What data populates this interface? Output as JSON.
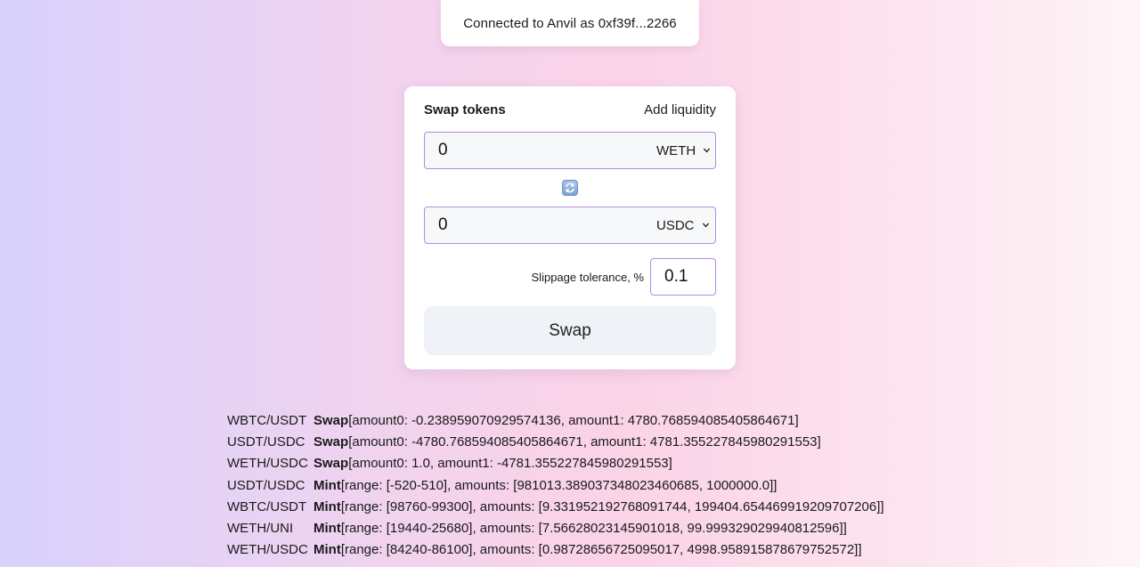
{
  "status": {
    "connected_text": "Connected to Anvil as 0xf39f...2266"
  },
  "tabs": {
    "swap_label": "Swap tokens",
    "liquidity_label": "Add liquidity"
  },
  "swap_form": {
    "from": {
      "amount": "0",
      "token": "WETH"
    },
    "to": {
      "amount": "0",
      "token": "USDC"
    },
    "switch_icon": "swap-arrows-icon",
    "slippage_label": "Slippage tolerance, %",
    "slippage_value": "0.1",
    "submit_label": "Swap"
  },
  "events": [
    {
      "pair": "WBTC/USDT",
      "type": "Swap",
      "details": "[amount0: -0.238959070929574136, amount1: 4780.768594085405864671]"
    },
    {
      "pair": "USDT/USDC",
      "type": "Swap",
      "details": "[amount0: -4780.768594085405864671, amount1: 4781.355227845980291553]"
    },
    {
      "pair": "WETH/USDC",
      "type": "Swap",
      "details": "[amount0: 1.0, amount1: -4781.355227845980291553]"
    },
    {
      "pair": "USDT/USDC",
      "type": "Mint",
      "details": "[range: [-520-510], amounts: [981013.389037348023460685, 1000000.0]]"
    },
    {
      "pair": "WBTC/USDT",
      "type": "Mint",
      "details": "[range: [98760-99300], amounts: [9.331952192768091744, 199404.654469919209707206]]"
    },
    {
      "pair": "WETH/UNI",
      "type": "Mint",
      "details": "[range: [19440-25680], amounts: [7.56628023145901018, 99.999329029940812596]]"
    },
    {
      "pair": "WETH/USDC",
      "type": "Mint",
      "details": "[range: [84240-86100], amounts: [0.98728656725095017, 4998.958915878679752572]]"
    }
  ]
}
